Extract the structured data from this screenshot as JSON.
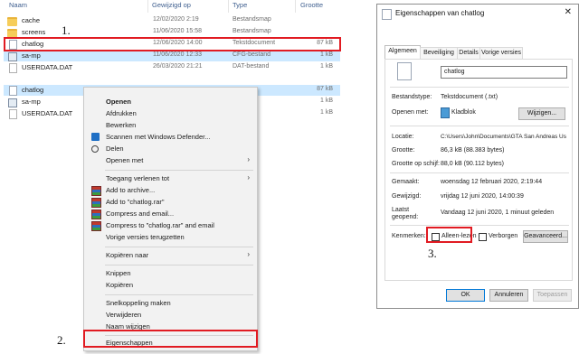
{
  "explorer": {
    "columns": {
      "name": "Naam",
      "date": "Gewijzigd op",
      "type": "Type",
      "size": "Grootte"
    },
    "top_rows": [
      {
        "name": "cache",
        "date": "12/02/2020 2:19",
        "type": "Bestandsmap",
        "size": "",
        "icon": "folder-icon"
      },
      {
        "name": "screens",
        "date": "11/06/2020 15:58",
        "type": "Bestandsmap",
        "size": "",
        "icon": "folder-icon"
      },
      {
        "name": "chatlog",
        "date": "12/06/2020 14:00",
        "type": "Tekstdocument",
        "size": "87 kB",
        "icon": "text-document-icon"
      },
      {
        "name": "sa-mp",
        "date": "11/06/2020 12:33",
        "type": "CFG-bestand",
        "size": "1 kB",
        "icon": "config-file-icon"
      },
      {
        "name": "USERDATA.DAT",
        "date": "26/03/2020 21:21",
        "type": "DAT-bestand",
        "size": "1 kB",
        "icon": "dat-file-icon"
      }
    ],
    "bottom_rows": [
      {
        "name": "chatlog",
        "size": "87 kB",
        "icon": "text-document-icon"
      },
      {
        "name": "sa-mp",
        "size": "1 kB",
        "icon": "config-file-icon"
      },
      {
        "name": "USERDATA.DAT",
        "size": "1 kB",
        "icon": "dat-file-icon"
      }
    ]
  },
  "steps": {
    "one": "1.",
    "two": "2.",
    "three": "3."
  },
  "context_menu": {
    "items": [
      {
        "label": "Openen",
        "bold": true
      },
      {
        "label": "Afdrukken"
      },
      {
        "label": "Bewerken"
      },
      {
        "label": "Scannen met Windows Defender...",
        "icon": "windows-defender-icon"
      },
      {
        "label": "Delen",
        "icon": "share-icon"
      },
      {
        "label": "Openen met",
        "submenu": true
      },
      {
        "label": "Toegang verlenen tot",
        "submenu": true
      },
      {
        "label": "Add to archive...",
        "icon": "winrar-icon"
      },
      {
        "label": "Add to \"chatlog.rar\"",
        "icon": "winrar-icon"
      },
      {
        "label": "Compress and email...",
        "icon": "winrar-icon"
      },
      {
        "label": "Compress to \"chatlog.rar\" and email",
        "icon": "winrar-icon"
      },
      {
        "label": "Vorige versies terugzetten"
      },
      {
        "label": "Kopiëren naar",
        "submenu": true
      },
      {
        "label": "Knippen"
      },
      {
        "label": "Kopiëren"
      },
      {
        "label": "Snelkoppeling maken"
      },
      {
        "label": "Verwijderen"
      },
      {
        "label": "Naam wijzigen"
      },
      {
        "label": "Eigenschappen"
      }
    ]
  },
  "properties": {
    "title": "Eigenschappen van chatlog",
    "close": "✕",
    "tabs": [
      "Algemeen",
      "Beveiliging",
      "Details",
      "Vorige versies"
    ],
    "filename": "chatlog",
    "labels": {
      "filetype": "Bestandstype:",
      "opens_with": "Openen met:",
      "location": "Locatie:",
      "size": "Grootte:",
      "size_on_disk": "Grootte op schijf:",
      "created": "Gemaakt:",
      "modified": "Gewijzigd:",
      "accessed_1": "Laatst",
      "accessed_2": "geopend:",
      "attributes": "Kenmerken:"
    },
    "values": {
      "filetype": "Tekstdocument (.txt)",
      "opens_with": "Kladblok",
      "location": "C:\\Users\\John\\Documents\\GTA San Andreas Us",
      "size": "86,3 kB (88.383 bytes)",
      "size_on_disk": "88,0 kB (90.112 bytes)",
      "created": "woensdag 12 februari 2020, 2:19:44",
      "modified": "vrijdag 12 juni 2020, 14:00:39",
      "accessed": "Vandaag 12 juni 2020, 1 minuut geleden"
    },
    "buttons": {
      "change": "Wijzigen...",
      "advanced": "Geavanceerd...",
      "ok": "OK",
      "cancel": "Annuleren",
      "apply": "Toepassen"
    },
    "checkboxes": {
      "readonly": "Alleen-lezen",
      "hidden": "Verborgen"
    }
  }
}
